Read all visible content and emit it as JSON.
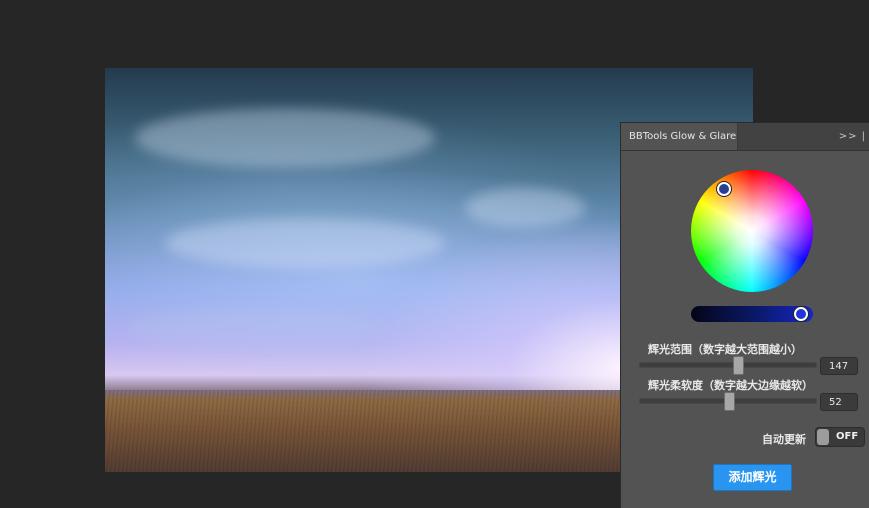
{
  "panel": {
    "tab_title": "BBTools Glow & Glare",
    "menu_icon": "flyout-menu-icon",
    "menu_glyph": ">> |"
  },
  "color_picker": {
    "selected_color": "#2a3f8f",
    "brightness_color": "#2233dd"
  },
  "controls": {
    "glow_range_label": "辉光范围（数字越大范围越小）",
    "glow_range_value": "147",
    "glow_range_fraction": 0.49,
    "softness_label": "辉光柔软度（数字越大边缘越软）",
    "softness_value": "52",
    "softness_fraction": 0.49,
    "auto_update_label": "自动更新",
    "auto_update_state": "OFF"
  },
  "actions": {
    "add_glow_label": "添加辉光"
  },
  "colors": {
    "accent": "#2a95f0",
    "panel_bg": "#535353",
    "workspace_bg": "#262626"
  }
}
